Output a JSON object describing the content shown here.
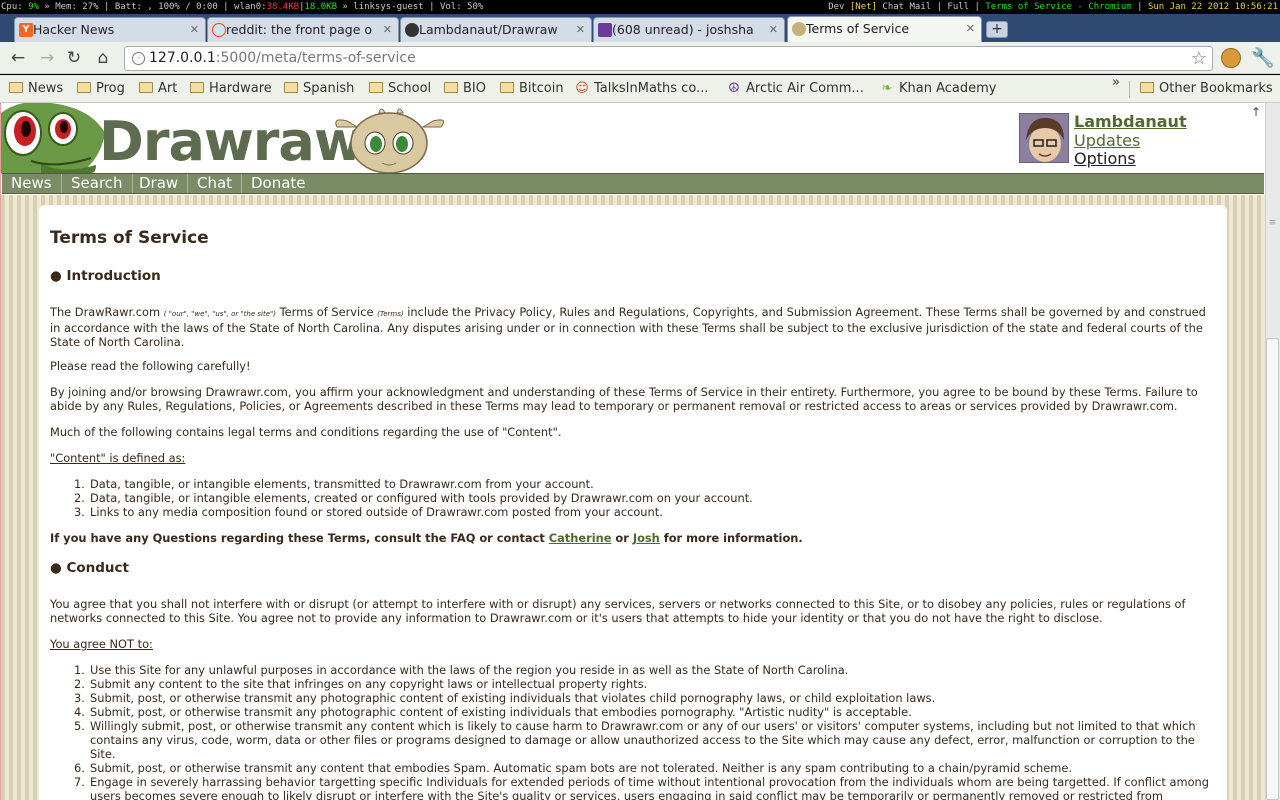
{
  "statusbar": {
    "cpu_label": "Cpu:",
    "cpu_value": "9%",
    "rest_1": "» Mem: 27% | Batt: , 100% / 0:00 | wlan0:",
    "down": "38.4KB",
    "sep": "|",
    "up": "18.0KB",
    "rest_2": "» linksys-guest | Vol: 50%",
    "right_1": "Dev",
    "right_net": "[Net]",
    "right_2": "Chat Mail | Full |",
    "right_title": "Terms of Service - Chromium",
    "right_3": "|",
    "right_date": "Sun Jan 22 2012 10:56:21"
  },
  "tabs": [
    {
      "label": "Hacker News",
      "icon": "Y"
    },
    {
      "label": "reddit: the front page o",
      "icon": "reddit-icon"
    },
    {
      "label": "Lambdanaut/Drawraw",
      "icon": "github-icon"
    },
    {
      "label": "(608 unread) - joshsha",
      "icon": "mail-icon"
    },
    {
      "label": "Terms of Service",
      "icon": "drawrawr-icon"
    }
  ],
  "toolbar": {
    "url_host": "127.0.0.1",
    "url_rest": ":5000/meta/terms-of-service"
  },
  "bookmarks": [
    {
      "label": "News",
      "icon": "folder"
    },
    {
      "label": "Prog",
      "icon": "folder"
    },
    {
      "label": "Art",
      "icon": "folder"
    },
    {
      "label": "Hardware",
      "icon": "folder"
    },
    {
      "label": "Spanish",
      "icon": "folder"
    },
    {
      "label": "School",
      "icon": "folder"
    },
    {
      "label": "BIO",
      "icon": "folder"
    },
    {
      "label": "Bitcoin",
      "icon": "folder"
    },
    {
      "label": "TalksInMaths co...",
      "icon": "reddit"
    },
    {
      "label": "Arctic Air Comm...",
      "icon": "peace"
    },
    {
      "label": "Khan Academy",
      "icon": "leaf"
    }
  ],
  "bookmarks_other": "Other Bookmarks",
  "site": {
    "logo": "Drawrawr",
    "user_name": "Lambdanaut",
    "updates": "Updates",
    "options": "Options",
    "nav": [
      "News",
      "Search",
      "Draw",
      "Chat",
      "Donate"
    ]
  },
  "doc": {
    "title": "Terms of Service",
    "intro_heading": "● Introduction",
    "intro_p1_a": "The DrawRawr.com",
    "intro_p1_small1": "( \"our\", \"we\", \"us\", or \"the site\")",
    "intro_p1_b": "Terms of Service",
    "intro_p1_small2": "(Terms)",
    "intro_p1_c": "include the Privacy Policy, Rules and Regulations, Copyrights, and Submission Agreement. These Terms shall be governed by and construed in accordance with the laws of the State of North Carolina. Any disputes arising under or in connection with these Terms shall be subject to the exclusive jurisdiction of the state and federal courts of the State of North Carolina.",
    "intro_p2": "Please read the following carefully!",
    "intro_p3": "By joining and/or browsing Drawrawr.com, you affirm your acknowledgment and understanding of these Terms of Service in their entirety. Furthermore, you agree to be bound by these Terms. Failure to abide by any Rules, Regulations, Policies, or Agreements described in these Terms may lead to temporary or permanent removal or restricted access to areas or services provided by Drawrawr.com.",
    "intro_p4": "Much of the following contains legal terms and conditions regarding the use of \"Content\".",
    "content_def": "\"Content\" is defined as:",
    "content_items": [
      "Data, tangible, or intangible elements, transmitted to Drawrawr.com from your account.",
      "Data, tangible, or intangible elements, created or configured with tools provided by Drawrawr.com on your account.",
      "Links to any media composition found or stored outside of Drawrawr.com posted from your account."
    ],
    "questions_a": "If you have any Questions regarding these Terms, consult the FAQ or contact",
    "questions_link1": "Catherine",
    "questions_or": "or",
    "questions_link2": "Josh",
    "questions_b": "for more information.",
    "conduct_heading": "● Conduct",
    "conduct_p1": "You agree that you shall not interfere with or disrupt (or attempt to interfere with or disrupt) any services, servers or networks connected to this Site, or to disobey any policies, rules or regulations of networks connected to this Site. You agree not to provide any information to Drawrawr.com or it's users that attempts to hide your identity or that you do not have the right to disclose.",
    "agree_not": "You agree NOT to:",
    "conduct_items": [
      "Use this Site for any unlawful purposes in accordance with the laws of the region you reside in as well as the State of North Carolina.",
      "Submit any content to the site that infringes on any copyright laws or intellectual property rights.",
      "Submit, post, or otherwise transmit any photographic content of existing individuals that violates child pornography laws, or child exploitation laws.",
      "Submit, post, or otherwise transmit any photographic content of existing individuals that embodies pornography. \"Artistic nudity\" is acceptable.",
      "Willingly submit, post, or otherwise transmit any content which is likely to cause harm to Drawrawr.com or any of our users' or visitors' computer systems, including but not limited to that which contains any virus, code, worm, data or other files or programs designed to damage or allow unauthorized access to the Site which may cause any defect, error, malfunction or corruption to the Site.",
      "Submit, post, or otherwise transmit any content that embodies Spam. Automatic spam bots are not tolerated. Neither is any spam contributing to a chain/pyramid scheme.",
      "Engage in severely harrassing behavior targetting specific Individuals for extended periods of time without intentional provocation from the individuals whom are being targetted. If conflict among users becomes severe enough to likely disrupt or interfere with the Site's quality or services, users engaging in said conflict may be temporarily or permanently removed or restricted from Drawrawr.com or it's services."
    ]
  }
}
